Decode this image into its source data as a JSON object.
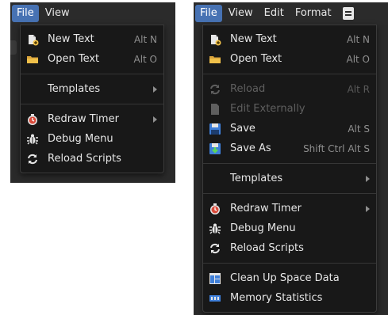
{
  "left": {
    "menubar": [
      {
        "label": "File",
        "active": true
      },
      {
        "label": "View",
        "active": false
      }
    ],
    "items": [
      {
        "type": "item",
        "icon": "new-file-icon",
        "label": "New Text",
        "shortcut": "Alt N"
      },
      {
        "type": "item",
        "icon": "folder-icon",
        "label": "Open Text",
        "shortcut": "Alt O"
      },
      {
        "type": "sep"
      },
      {
        "type": "item",
        "icon": "",
        "label": "Templates",
        "submenu": true
      },
      {
        "type": "sep"
      },
      {
        "type": "item",
        "icon": "timer-icon",
        "label": "Redraw Timer",
        "submenu": true
      },
      {
        "type": "item",
        "icon": "bug-icon",
        "label": "Debug Menu"
      },
      {
        "type": "item",
        "icon": "reload-icon",
        "label": "Reload Scripts"
      }
    ]
  },
  "right": {
    "menubar": [
      {
        "label": "File",
        "active": true
      },
      {
        "label": "View",
        "active": false
      },
      {
        "label": "Edit",
        "active": false
      },
      {
        "label": "Format",
        "active": false
      }
    ],
    "items": [
      {
        "type": "item",
        "icon": "new-file-icon",
        "label": "New Text",
        "shortcut": "Alt N"
      },
      {
        "type": "item",
        "icon": "folder-icon",
        "label": "Open Text",
        "shortcut": "Alt O"
      },
      {
        "type": "sep"
      },
      {
        "type": "item",
        "icon": "reload-icon",
        "label": "Reload",
        "shortcut": "Alt R",
        "disabled": true
      },
      {
        "type": "item",
        "icon": "file-icon",
        "label": "Edit Externally",
        "disabled": true
      },
      {
        "type": "item",
        "icon": "save-icon",
        "label": "Save",
        "shortcut": "Alt S"
      },
      {
        "type": "item",
        "icon": "save-as-icon",
        "label": "Save As",
        "shortcut": "Shift Ctrl Alt S"
      },
      {
        "type": "sep"
      },
      {
        "type": "item",
        "icon": "",
        "label": "Templates",
        "submenu": true
      },
      {
        "type": "sep"
      },
      {
        "type": "item",
        "icon": "timer-icon",
        "label": "Redraw Timer",
        "submenu": true
      },
      {
        "type": "item",
        "icon": "bug-icon",
        "label": "Debug Menu"
      },
      {
        "type": "item",
        "icon": "reload-icon",
        "label": "Reload Scripts"
      },
      {
        "type": "sep"
      },
      {
        "type": "item",
        "icon": "cleanup-icon",
        "label": "Clean Up Space Data"
      },
      {
        "type": "item",
        "icon": "memory-icon",
        "label": "Memory Statistics"
      }
    ]
  },
  "colors": {
    "accent": "#4772b3",
    "menu_bg": "#181818",
    "text": "#e6e6e6",
    "disabled_text": "#5f5f5f",
    "shortcut_text": "#8f8f8f"
  }
}
